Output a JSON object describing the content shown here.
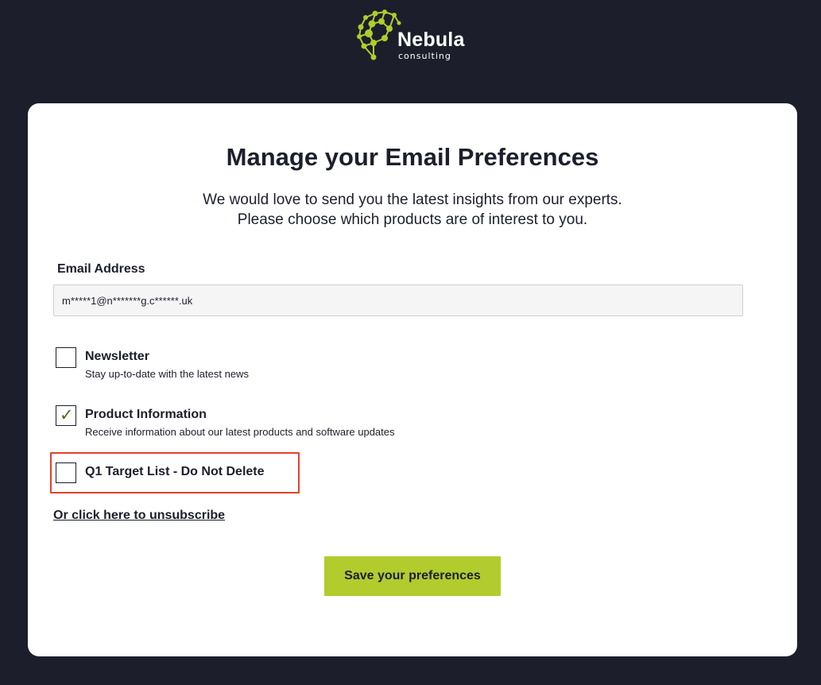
{
  "brand": {
    "name": "Nebula",
    "tagline": "consulting",
    "accent_color": "#b2cc2e",
    "background_color": "#1c1f2b",
    "logo_icon": "molecule-network-icon"
  },
  "page": {
    "title": "Manage your Email Preferences",
    "intro_line_1": "We would love to send you the latest insights from our experts.",
    "intro_line_2": "Please choose which products are of interest to you."
  },
  "email": {
    "label": "Email Address",
    "value": "m*****1@n*******g.c******.uk"
  },
  "preferences": [
    {
      "title": "Newsletter",
      "description": "Stay up-to-date with the latest news",
      "checked": false
    },
    {
      "title": "Product Information",
      "description": "Receive information about our latest products and software updates",
      "checked": true
    },
    {
      "title": "Q1 Target List - Do Not Delete",
      "description": "",
      "checked": false
    }
  ],
  "annotation": {
    "highlight_color": "#e5412b",
    "highlighted_item": "Q1 Target List - Do Not Delete"
  },
  "actions": {
    "unsubscribe_label": "Or click here to unsubscribe",
    "save_label": "Save your preferences"
  },
  "icons": {
    "check_mark": "✓"
  }
}
